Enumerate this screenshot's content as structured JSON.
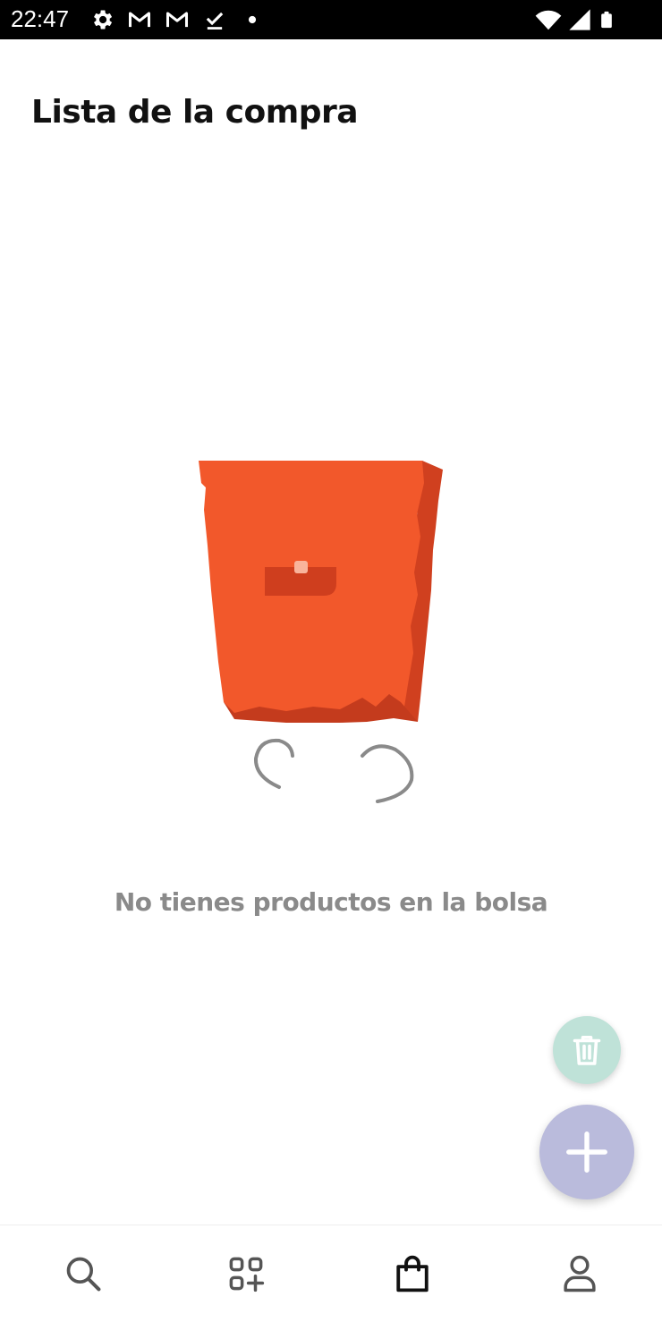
{
  "status_bar": {
    "time": "22:47",
    "left_icons": [
      "settings-icon",
      "gmail-icon",
      "gmail-icon",
      "download-done-icon",
      "dot-icon"
    ],
    "right_icons": [
      "wifi-icon",
      "signal-icon",
      "battery-icon"
    ]
  },
  "header": {
    "title": "Lista de la compra"
  },
  "empty_state": {
    "illustration": "empty-shopping-bag-illustration",
    "message": "No tienes productos en la bolsa"
  },
  "fabs": {
    "delete_icon": "trash-icon",
    "add_icon": "plus-icon"
  },
  "bottom_nav": {
    "items": [
      {
        "icon": "search-icon",
        "active": false
      },
      {
        "icon": "categories-add-icon",
        "active": false
      },
      {
        "icon": "shopping-bag-icon",
        "active": true
      },
      {
        "icon": "profile-icon",
        "active": false
      }
    ]
  },
  "colors": {
    "bag_orange": "#f2582b",
    "bag_shadow": "#d0401f",
    "delete_fab": "#bfe2d8",
    "add_fab": "#babbdc",
    "message_gray": "#8a8a8a"
  }
}
